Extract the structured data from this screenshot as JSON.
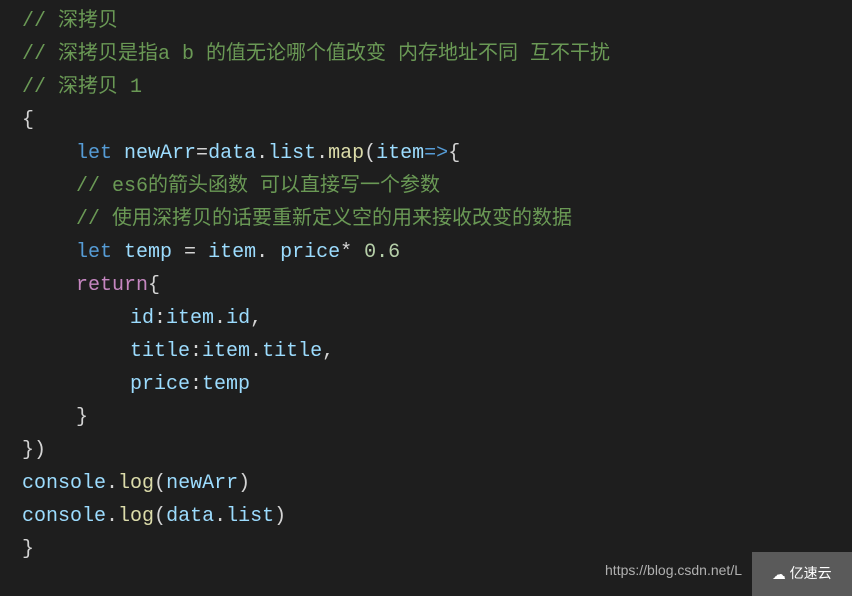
{
  "code": {
    "line1_comment": "// 深拷贝",
    "line2_comment": "// 深拷贝是指a b 的值无论哪个值改变 内存地址不同 互不干扰",
    "line3_blank": "",
    "line4_comment": "// 深拷贝 1",
    "line5_brace": "{",
    "line6": {
      "let": "let",
      "newArr": "newArr",
      "eq": "=",
      "data": "data",
      "dot1": ".",
      "list": "list",
      "dot2": ".",
      "map": "map",
      "paren1": "(",
      "item": "item",
      "arrow": "=>",
      "brace": "{"
    },
    "line7_comment": "// es6的箭头函数 可以直接写一个参数",
    "line8_comment": "// 使用深拷贝的话要重新定义空的用来接收改变的数据",
    "line9": {
      "let": "let",
      "temp": "temp",
      "eq": " = ",
      "item": "item",
      "dot": ". ",
      "price": "price",
      "mult": "* ",
      "num": "0.6"
    },
    "line10": {
      "return": "return",
      "brace": "{"
    },
    "line11": {
      "id": "id",
      "colon": ":",
      "item": "item",
      "dot": ".",
      "id2": "id",
      "comma": ","
    },
    "line12": {
      "title": "title",
      "colon": ":",
      "item": "item",
      "dot": ".",
      "title2": "title",
      "comma": ","
    },
    "line13": {
      "price": "price",
      "colon": ":",
      "temp": "temp"
    },
    "line14_brace": "}",
    "line15_close": "})",
    "line16": {
      "console": "console",
      "dot": ".",
      "log": "log",
      "paren1": "(",
      "newArr": "newArr",
      "paren2": ")"
    },
    "line17": {
      "console": "console",
      "dot": ".",
      "log": "log",
      "paren1": "(",
      "data": "data",
      "dot2": ".",
      "list": "list",
      "paren2": ")"
    },
    "line18_brace": "}"
  },
  "watermark": {
    "url": "https://blog.csdn.net/L",
    "brand": "亿速云"
  }
}
